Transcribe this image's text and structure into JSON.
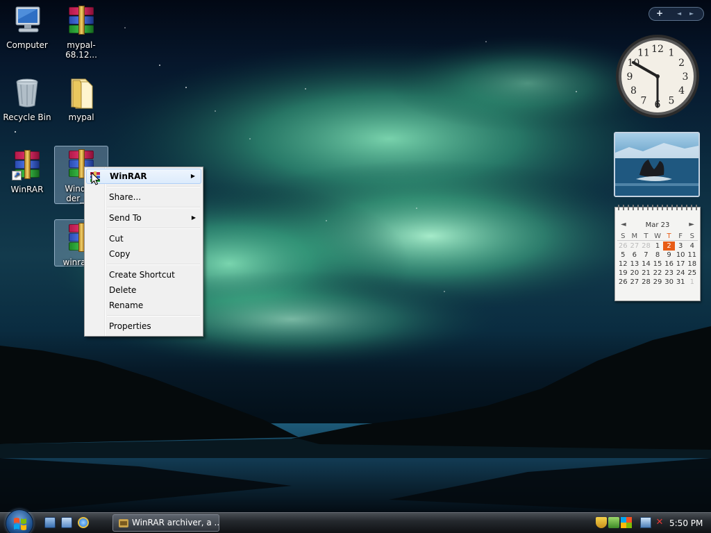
{
  "desktop": {
    "icons": [
      {
        "label": "Computer"
      },
      {
        "label": "mypal-68.12..."
      },
      {
        "label": "Recycle Bin"
      },
      {
        "label": "mypal"
      },
      {
        "label": "WinRAR"
      },
      {
        "label_line1": "Window",
        "label_line2": "der_v..."
      },
      {
        "label": "winrar-..."
      }
    ]
  },
  "context_menu": {
    "items": [
      {
        "label": "WinRAR",
        "submenu": true
      },
      {
        "label": "Share..."
      },
      {
        "label": "Send To",
        "submenu": true
      },
      {
        "label": "Cut"
      },
      {
        "label": "Copy"
      },
      {
        "label": "Create Shortcut"
      },
      {
        "label": "Delete"
      },
      {
        "label": "Rename"
      },
      {
        "label": "Properties"
      }
    ]
  },
  "sidebar": {
    "add_gadget": "+",
    "prev": "◄",
    "next": "►"
  },
  "clock": {
    "numbers": [
      "12",
      "1",
      "2",
      "3",
      "4",
      "5",
      "6",
      "7",
      "8",
      "9",
      "10",
      "11"
    ],
    "time": "5:50"
  },
  "calendar": {
    "month": "Mar 23",
    "prev": "◄",
    "next": "►",
    "weekdays": [
      "S",
      "M",
      "T",
      "W",
      "T",
      "F",
      "S"
    ],
    "weeks": [
      [
        "26",
        "27",
        "28",
        "1",
        "2",
        "3",
        "4"
      ],
      [
        "5",
        "6",
        "7",
        "8",
        "9",
        "10",
        "11"
      ],
      [
        "12",
        "13",
        "14",
        "15",
        "16",
        "17",
        "18"
      ],
      [
        "19",
        "20",
        "21",
        "22",
        "23",
        "24",
        "25"
      ],
      [
        "26",
        "27",
        "28",
        "29",
        "30",
        "31",
        "1"
      ]
    ],
    "today": "2",
    "accent_color": "#e85b15"
  },
  "taskbar": {
    "task_button": "WinRAR archiver, a ...",
    "clock": "5:50 PM"
  }
}
